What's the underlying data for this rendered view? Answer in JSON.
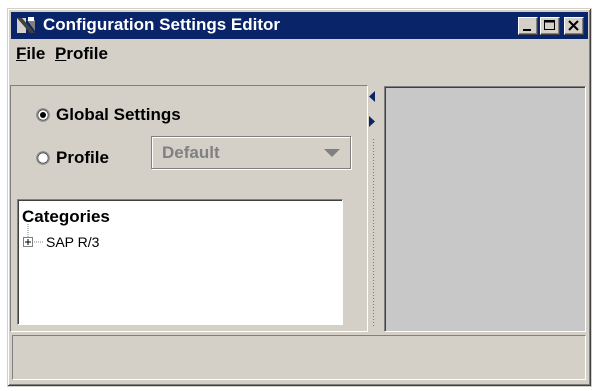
{
  "window": {
    "title": "Configuration Settings Editor"
  },
  "menu": {
    "file": {
      "mnemonic": "F",
      "rest": "ile"
    },
    "profile": {
      "mnemonic": "P",
      "rest": "rofile"
    }
  },
  "scope": {
    "global_label": "Global Settings",
    "global_selected": true,
    "profile_label": "Profile",
    "profile_selected": false,
    "profile_combo_value": "Default",
    "profile_combo_enabled": false
  },
  "categories": {
    "heading": "Categories",
    "nodes": [
      {
        "label": "SAP R/3",
        "expanded": false
      }
    ]
  },
  "icons": {
    "app": "configuration-app-icon",
    "minimize": "minimize-icon",
    "maximize": "maximize-icon",
    "close": "close-icon",
    "combo_arrow": "chevron-down-icon",
    "collapse_left": "triangle-left-icon",
    "collapse_right": "triangle-right-icon",
    "tree_expander": "plus-box-icon"
  },
  "colors": {
    "titlebar": "#0a246a",
    "face": "#d4d0c8",
    "disabled_text": "#808080"
  }
}
